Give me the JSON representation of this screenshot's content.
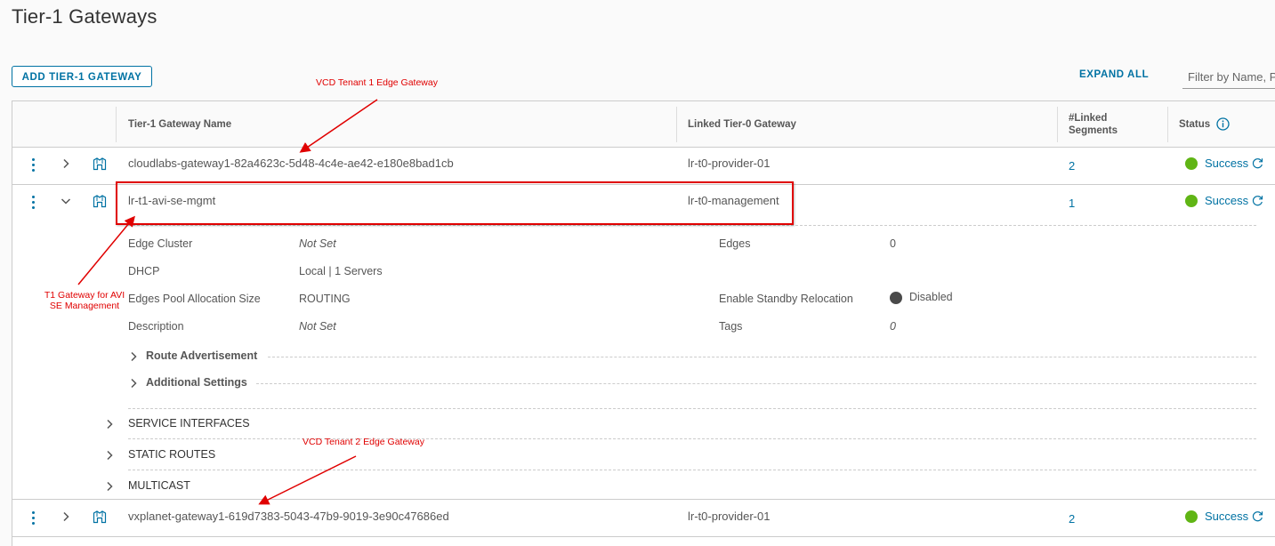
{
  "page": {
    "title": "Tier-1 Gateways"
  },
  "toolbar": {
    "add_label": "ADD TIER-1 GATEWAY",
    "expand_all_label": "EXPAND ALL",
    "filter_placeholder": "Filter by Name, Path and more"
  },
  "table": {
    "columns": [
      "Tier-1 Gateway Name",
      "Linked Tier-0 Gateway",
      "#Linked\nSegments",
      "Status"
    ],
    "col_segments_line1": "#Linked",
    "col_segments_line2": "Segments",
    "rows": [
      {
        "name": "cloudlabs-gateway1-82a4623c-5d48-4c4e-ae42-e180e8bad1cb",
        "tier0": "lr-t0-provider-01",
        "segments": "2",
        "status": "Success"
      },
      {
        "name": "lr-t1-avi-se-mgmt",
        "tier0": "lr-t0-management",
        "segments": "1",
        "status": "Success",
        "expanded": true
      },
      {
        "name": "vxplanet-gateway1-619d7383-5043-47b9-9019-3e90c47686ed",
        "tier0": "lr-t0-provider-01",
        "segments": "2",
        "status": "Success"
      }
    ]
  },
  "details": {
    "edge_cluster_label": "Edge Cluster",
    "edge_cluster_value": "Not Set",
    "dhcp_label": "DHCP",
    "dhcp_value": "Local | 1 Servers",
    "pool_label": "Edges Pool Allocation Size",
    "pool_value": "ROUTING",
    "description_label": "Description",
    "description_value": "Not Set",
    "edges_label": "Edges",
    "edges_value": "0",
    "standby_label": "Enable Standby Relocation",
    "standby_value": "Disabled",
    "tags_label": "Tags",
    "tags_value": "0",
    "route_adv_label": "Route Advertisement",
    "additional_label": "Additional Settings",
    "service_interfaces_label": "SERVICE INTERFACES",
    "static_routes_label": "STATIC ROUTES",
    "multicast_label": "MULTICAST"
  },
  "annotations": {
    "tenant1": "VCD Tenant 1 Edge Gateway",
    "t1_line1": "T1 Gateway for AVI",
    "t1_line2": "SE Management",
    "tenant2": "VCD Tenant 2 Edge Gateway"
  },
  "colors": {
    "link": "#0072a3",
    "success": "#60b515",
    "annotation": "#e00000"
  }
}
